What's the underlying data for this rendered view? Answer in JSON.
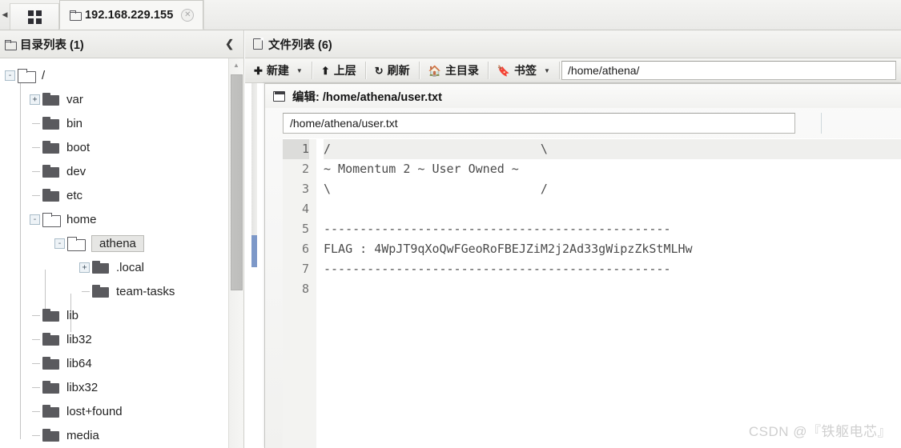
{
  "tabbar": {
    "grid_icon": "grid-icon",
    "tabs": [
      {
        "label": "192.168.229.155",
        "icon": "folder-icon",
        "close_icon": "close-icon",
        "active": true
      }
    ]
  },
  "sidebar": {
    "header": {
      "icon": "folder-icon",
      "title": "目录列表 (1)",
      "collapse_icon": "chevron-left-icon"
    },
    "tree": [
      {
        "label": "/",
        "depth": 0,
        "toggle": "-",
        "folder": "open"
      },
      {
        "label": "var",
        "depth": 1,
        "toggle": "+",
        "folder": "closed"
      },
      {
        "label": "bin",
        "depth": 1,
        "toggle": "",
        "folder": "closed"
      },
      {
        "label": "boot",
        "depth": 1,
        "toggle": "",
        "folder": "closed"
      },
      {
        "label": "dev",
        "depth": 1,
        "toggle": "",
        "folder": "closed"
      },
      {
        "label": "etc",
        "depth": 1,
        "toggle": "",
        "folder": "closed"
      },
      {
        "label": "home",
        "depth": 1,
        "toggle": "-",
        "folder": "open"
      },
      {
        "label": "athena",
        "depth": 2,
        "toggle": "-",
        "folder": "open",
        "selected": true
      },
      {
        "label": ".local",
        "depth": 3,
        "toggle": "+",
        "folder": "closed"
      },
      {
        "label": "team-tasks",
        "depth": 3,
        "toggle": "",
        "folder": "closed"
      },
      {
        "label": "lib",
        "depth": 1,
        "toggle": "",
        "folder": "closed"
      },
      {
        "label": "lib32",
        "depth": 1,
        "toggle": "",
        "folder": "closed"
      },
      {
        "label": "lib64",
        "depth": 1,
        "toggle": "",
        "folder": "closed"
      },
      {
        "label": "libx32",
        "depth": 1,
        "toggle": "",
        "folder": "closed"
      },
      {
        "label": "lost+found",
        "depth": 1,
        "toggle": "",
        "folder": "closed"
      },
      {
        "label": "media",
        "depth": 1,
        "toggle": "",
        "folder": "closed"
      }
    ],
    "scrollbar": {
      "up_icon": "scroll-up-icon"
    }
  },
  "main": {
    "header": {
      "icon": "file-icon",
      "title": "文件列表 (6)"
    },
    "toolbar": {
      "new_label": "新建",
      "new_icon": "plus-circle-icon",
      "new_caret": "chevron-down-icon",
      "up_label": "上层",
      "up_icon": "arrow-up-icon",
      "refresh_label": "刷新",
      "refresh_icon": "refresh-icon",
      "home_label": "主目录",
      "home_icon": "home-icon",
      "bookmark_label": "书签",
      "bookmark_icon": "bookmark-icon",
      "bookmark_caret": "chevron-down-icon",
      "path_value": "/home/athena/"
    }
  },
  "editor": {
    "window_icon": "window-icon",
    "title": "编辑: /home/athena/user.txt",
    "path_value": "/home/athena/user.txt",
    "path_placeholder": "/home/athena/user.txt",
    "current_line": 1,
    "lines": [
      {
        "n": "1",
        "text": "/                             \\"
      },
      {
        "n": "2",
        "text": "~ Momentum 2 ~ User Owned ~"
      },
      {
        "n": "3",
        "text": "\\                             /"
      },
      {
        "n": "4",
        "text": ""
      },
      {
        "n": "5",
        "text": "------------------------------------------------"
      },
      {
        "n": "6",
        "text": "FLAG : 4WpJT9qXoQwFGeoRoFBEJZiM2j2Ad33gWipzZkStMLHw"
      },
      {
        "n": "7",
        "text": "------------------------------------------------"
      },
      {
        "n": "8",
        "text": ""
      }
    ]
  },
  "watermark": {
    "text": "CSDN @『铁躯电芯』"
  }
}
